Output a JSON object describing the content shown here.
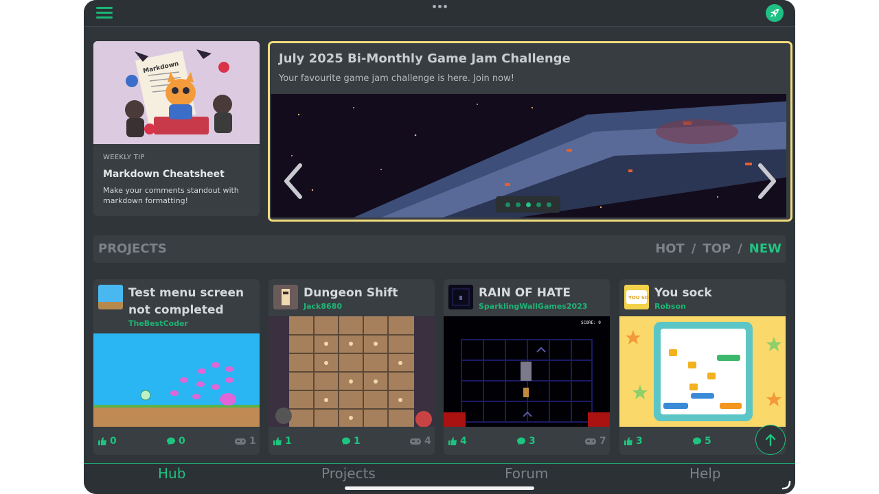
{
  "topbar": {
    "menu_icon": "hamburger-menu-icon",
    "more_icon": "ellipsis-icon",
    "rocket_icon": "rocket-icon"
  },
  "tip": {
    "kicker": "WEEKLY TIP",
    "title": "Markdown Cheatsheet",
    "description": "Make your comments standout with markdown formatting!",
    "image_paper_text": "Markdown"
  },
  "hero": {
    "title": "July 2025 Bi-Monthly Game Jam Challenge",
    "subtitle": "Your favourite game jam challenge is here. Join now!",
    "slide_count": 5,
    "active_slide": 3
  },
  "projects": {
    "title": "PROJECTS",
    "sort": [
      "HOT",
      "TOP",
      "NEW"
    ],
    "sort_separator": "/",
    "active_sort": "NEW"
  },
  "cards": [
    {
      "title": "Test menu screen not completed",
      "author": "TheBestCoder",
      "likes": "0",
      "comments": "0",
      "plays": "1"
    },
    {
      "title": "Dungeon Shift",
      "author": "Jack8680",
      "likes": "1",
      "comments": "1",
      "plays": "4"
    },
    {
      "title": "RAIN OF HATE",
      "author": "SparklingWallGames2023",
      "likes": "4",
      "comments": "3",
      "plays": "7",
      "score_text": "SCORE: 0"
    },
    {
      "title": "You sock",
      "author": "Robson",
      "likes": "3",
      "comments": "5",
      "thumb_text": "YOU SOCK"
    }
  ],
  "nav": {
    "items": [
      "Hub",
      "Projects",
      "Forum",
      "Help"
    ],
    "active": "Hub"
  },
  "colors": {
    "accent": "#21c382",
    "hero_border": "#f1dc7e",
    "background": "#2f3539",
    "card": "#383e42"
  }
}
